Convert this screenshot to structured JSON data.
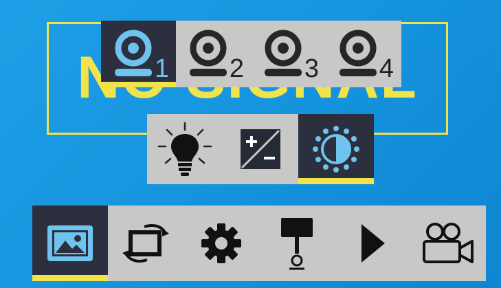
{
  "background": {
    "no_signal_text": "NO SIGNAL",
    "frame_color": "#f3e34a"
  },
  "colors": {
    "accent": "#f3e34a",
    "selected_bg": "#2b2f3e",
    "bar_bg": "#c8c8c6",
    "selected_icon": "#6fc3ee"
  },
  "camera_bar": {
    "items": [
      {
        "number": "1",
        "icon": "camera-icon",
        "selected": true
      },
      {
        "number": "2",
        "icon": "camera-icon",
        "selected": false
      },
      {
        "number": "3",
        "icon": "camera-icon",
        "selected": false
      },
      {
        "number": "4",
        "icon": "camera-icon",
        "selected": false
      }
    ]
  },
  "adjust_bar": {
    "items": [
      {
        "icon": "brightness-bulb-icon",
        "selected": false
      },
      {
        "icon": "contrast-plus-minus-icon",
        "selected": false
      },
      {
        "icon": "saturation-dial-icon",
        "selected": true
      }
    ]
  },
  "main_menu": {
    "items": [
      {
        "icon": "picture-icon",
        "selected": true
      },
      {
        "icon": "rotate-screen-icon",
        "selected": false
      },
      {
        "icon": "settings-gear-icon",
        "selected": false
      },
      {
        "icon": "display-stand-icon",
        "selected": false
      },
      {
        "icon": "play-icon",
        "selected": false
      },
      {
        "icon": "video-camera-icon",
        "selected": false
      }
    ]
  }
}
